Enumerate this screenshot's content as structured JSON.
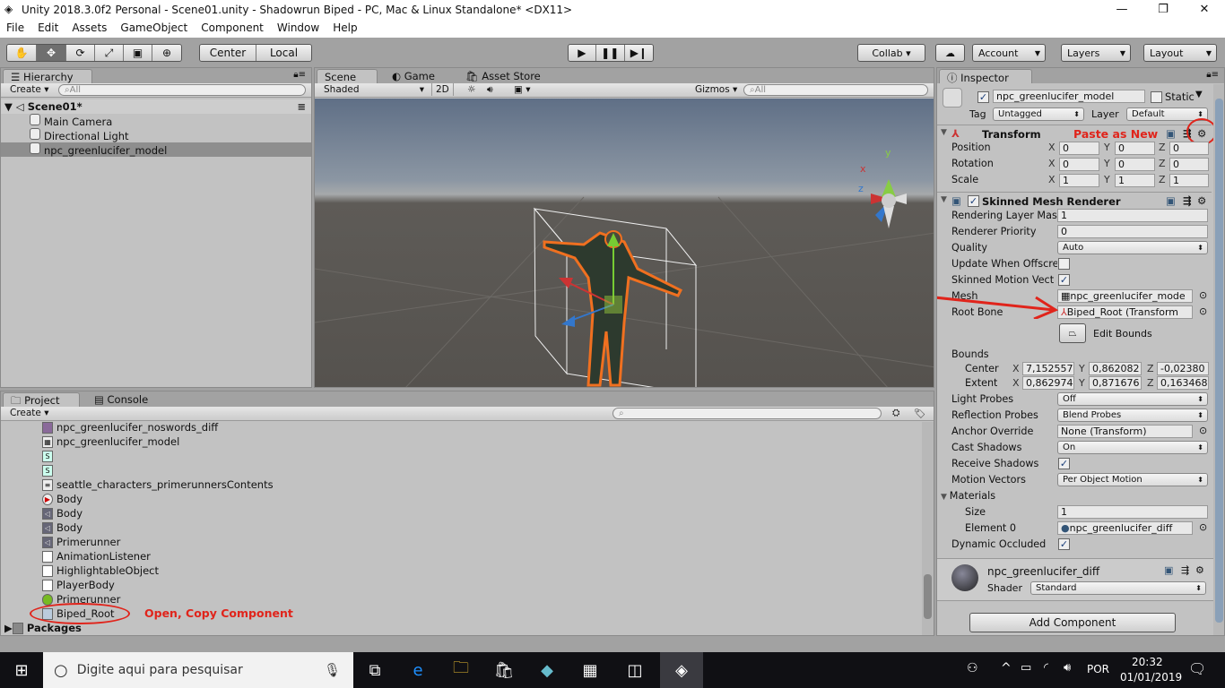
{
  "window": {
    "title": "Unity 2018.3.0f2 Personal - Scene01.unity - Shadowrun Biped - PC, Mac & Linux Standalone* <DX11>",
    "min": "—",
    "restore": "❐",
    "close": "✕"
  },
  "menu": [
    "File",
    "Edit",
    "Assets",
    "GameObject",
    "Component",
    "Window",
    "Help"
  ],
  "toolbar": {
    "center": "Center",
    "local": "Local",
    "collab": "Collab ▾",
    "account": "Account",
    "layers": "Layers",
    "layout": "Layout"
  },
  "hierarchy": {
    "tab": "Hierarchy",
    "create": "Create",
    "search": "All",
    "scene": "Scene01*",
    "items": [
      "Main Camera",
      "Directional Light",
      "npc_greenlucifer_model"
    ]
  },
  "scene": {
    "tabs": [
      "Scene",
      "Game",
      "Asset Store"
    ],
    "shading": "Shaded",
    "mode2d": "2D",
    "gizmos": "Gizmos",
    "search": "All",
    "axis_x": "x",
    "axis_y": "y",
    "axis_z": "z"
  },
  "project": {
    "tabs": [
      "Project",
      "Console"
    ],
    "create": "Create",
    "items": [
      "npc_greenlucifer_noswords_diff",
      "npc_greenlucifer_model",
      "",
      "",
      "seattle_characters_primerunnersContents",
      "Body",
      "Body",
      "Body",
      "Primerunner",
      "AnimationListener",
      "HighlightableObject",
      "PlayerBody",
      "Primerunner",
      "Biped_Root"
    ],
    "packages": "Packages",
    "annotation": "Open, Copy Component"
  },
  "inspector": {
    "tab": "Inspector",
    "object_name": "npc_greenlucifer_model",
    "static": "Static",
    "tag_label": "Tag",
    "tag": "Untagged",
    "layer_label": "Layer",
    "layer": "Default",
    "transform": {
      "title": "Transform",
      "annotation": "Paste as New",
      "rows": [
        {
          "label": "Position",
          "x": "0",
          "y": "0",
          "z": "0"
        },
        {
          "label": "Rotation",
          "x": "0",
          "y": "0",
          "z": "0"
        },
        {
          "label": "Scale",
          "x": "1",
          "y": "1",
          "z": "1"
        }
      ]
    },
    "smr": {
      "title": "Skinned Mesh Renderer",
      "rendering_layer_label": "Rendering Layer Mas",
      "rendering_layer": "1",
      "priority_label": "Renderer Priority",
      "priority": "0",
      "quality_label": "Quality",
      "quality": "Auto",
      "offscreen_label": "Update When Offscre",
      "motion_vec_label": "Skinned Motion Vect",
      "mesh_label": "Mesh",
      "mesh": "npc_greenlucifer_mode",
      "rootbone_label": "Root Bone",
      "rootbone": "Biped_Root (Transform",
      "edit_bounds": "Edit Bounds",
      "bounds_label": "Bounds",
      "center_label": "Center",
      "center": {
        "x": "7,152557",
        "y": "0,862082",
        "z": "-0,02380"
      },
      "extent_label": "Extent",
      "extent": {
        "x": "0,862974",
        "y": "0,871676",
        "z": "0,163468"
      },
      "light_probes_label": "Light Probes",
      "light_probes": "Off",
      "refl_label": "Reflection Probes",
      "refl": "Blend Probes",
      "anchor_label": "Anchor Override",
      "anchor": "None (Transform)",
      "cast_label": "Cast Shadows",
      "cast": "On",
      "receive_label": "Receive Shadows",
      "mv_label": "Motion Vectors",
      "mv": "Per Object Motion",
      "materials_label": "Materials",
      "size_label": "Size",
      "size": "1",
      "el0_label": "Element 0",
      "el0": "npc_greenlucifer_diff",
      "dyn_label": "Dynamic Occluded"
    },
    "material": {
      "name": "npc_greenlucifer_diff",
      "shader_label": "Shader",
      "shader": "Standard"
    },
    "add_component": "Add Component"
  },
  "taskbar": {
    "search": "Digite aqui para pesquisar",
    "lang": "POR",
    "time": "20:32",
    "date": "01/01/2019"
  }
}
